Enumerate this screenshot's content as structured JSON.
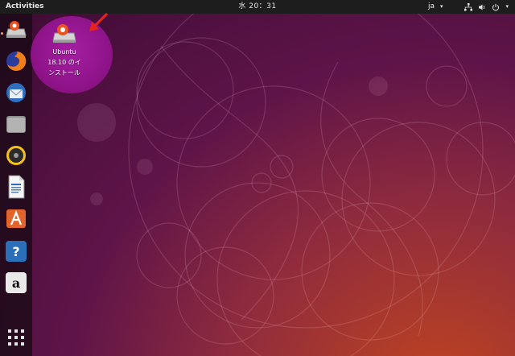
{
  "topbar": {
    "activities": "Activities",
    "clock": "水 20：31",
    "input_method": "ja",
    "icons": [
      "network-icon",
      "volume-icon",
      "power-icon",
      "chevron-down-icon"
    ]
  },
  "dock": {
    "items": [
      {
        "name": "ubuntu-installer",
        "icon": "installer-icon",
        "running": true
      },
      {
        "name": "firefox",
        "icon": "firefox-icon"
      },
      {
        "name": "thunderbird",
        "icon": "thunderbird-icon"
      },
      {
        "name": "files",
        "icon": "folder-icon"
      },
      {
        "name": "rhythmbox",
        "icon": "speaker-icon"
      },
      {
        "name": "libreoffice-writer",
        "icon": "document-icon"
      },
      {
        "name": "ubuntu-software",
        "icon": "software-center-icon"
      },
      {
        "name": "help",
        "icon": "help-icon",
        "glyph": "?"
      },
      {
        "name": "amazon",
        "icon": "amazon-icon",
        "glyph": "a"
      },
      {
        "name": "show-applications",
        "icon": "app-grid-icon"
      }
    ]
  },
  "desktop": {
    "installer_label_lines": [
      "Ubuntu",
      "18.10 のイ",
      "ンストール"
    ]
  },
  "annotation": {
    "icon": "red-arrow-icon",
    "color": "#e8231c"
  },
  "colors": {
    "accent": "#e95420",
    "selection": "#9a1b96",
    "topbar": "#1d1d1d"
  }
}
